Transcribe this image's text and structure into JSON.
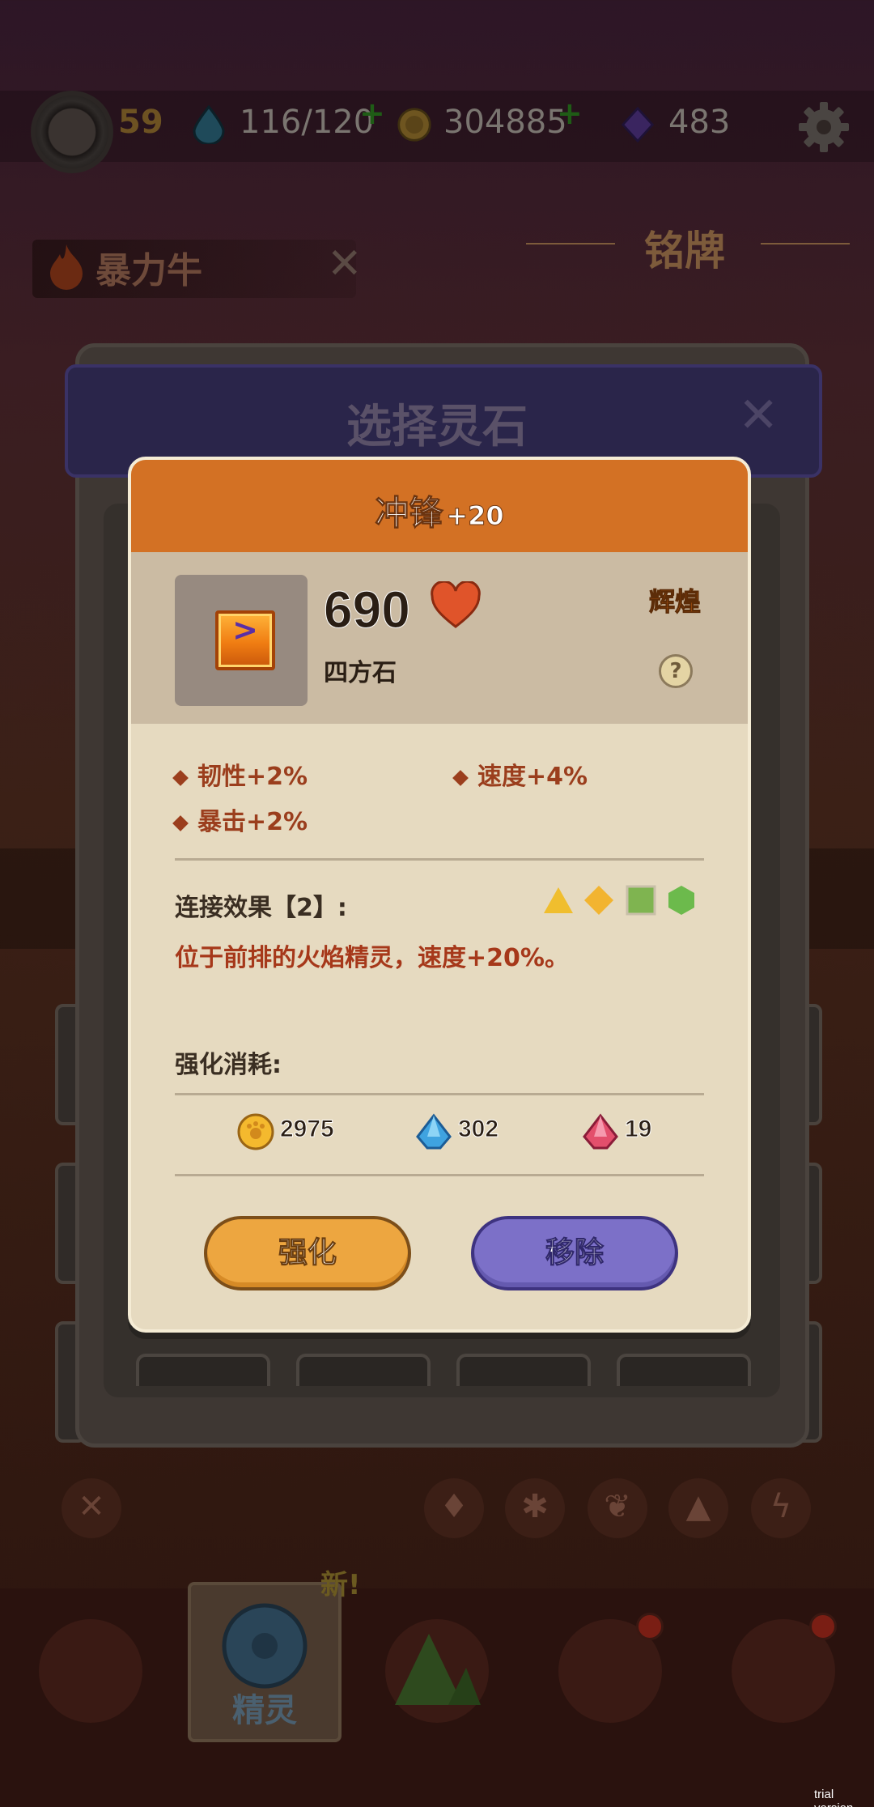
{
  "hud": {
    "level": "59",
    "energy": "116/120",
    "coins": "304885",
    "gems": "483",
    "plus": "+"
  },
  "pet": {
    "name": "暴力牛",
    "close": "✕"
  },
  "plaque": {
    "title": "铭牌"
  },
  "select_panel": {
    "title": "选择灵石",
    "close": "✕"
  },
  "dialog": {
    "title": "冲锋",
    "level": "+20",
    "power": "690",
    "stone_type": "四方石",
    "rarity": "辉煌",
    "help": "?",
    "stats": [
      {
        "text": "韧性+2%"
      },
      {
        "text": "速度+4%"
      },
      {
        "text": "暴击+2%"
      }
    ],
    "link_label": "连接效果【2】:",
    "link_desc": "位于前排的火焰精灵，速度+20%。",
    "cost_title": "强化消耗:",
    "costs": {
      "coin": "2975",
      "blue_crystal": "302",
      "red_crystal": "19"
    },
    "buttons": {
      "enhance": "强化",
      "remove": "移除"
    }
  },
  "nav": {
    "active_label": "精灵",
    "new_badge": "新!"
  },
  "watermark": "trial version",
  "colors": {
    "dialog_header": "#d37124",
    "stat_text": "#9b3e1d",
    "enhance_button": "#eda640",
    "remove_button": "#7c70c8"
  }
}
